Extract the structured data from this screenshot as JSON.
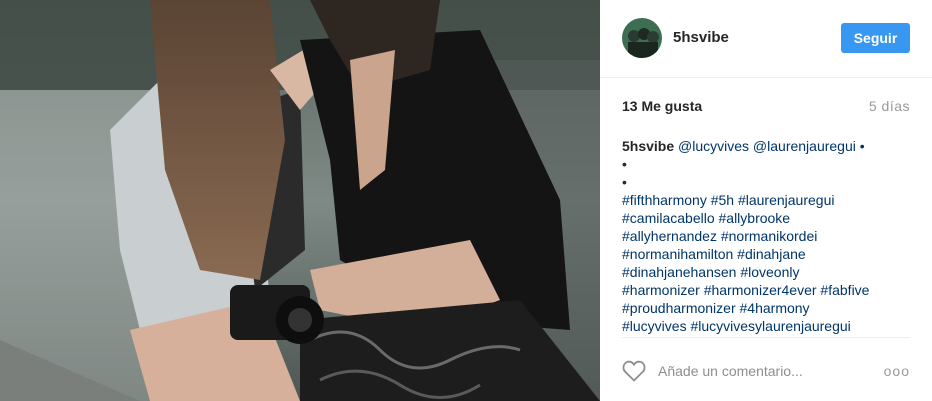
{
  "post": {
    "username": "5hsvibe",
    "follow_label": "Seguir",
    "likes": "13 Me gusta",
    "date": "5 días",
    "caption": {
      "author": "5hsvibe",
      "lines": [
        " @lucyvives @laurenjauregui •",
        "•",
        "•",
        "#fifthharmony #5h #laurenjauregui",
        "#camilacabello #allybrooke",
        "#allyhernandez #normanikordei",
        "#normanihamilton #dinahjane",
        "#dinahjanehansen #loveonly",
        "#harmonizer #harmonizer4ever #fabfive",
        "#proudharmonizer #4harmony",
        "#lucyvives #lucyvivesylaurenjauregui"
      ]
    },
    "comment_placeholder": "Añade un comentario...",
    "more_label": "ooo"
  },
  "icons": {
    "like": "heart-outline-icon",
    "options": "more-options-icon"
  },
  "colors": {
    "follow_button": "#3897f0",
    "link": "#003569",
    "muted": "#999999"
  }
}
